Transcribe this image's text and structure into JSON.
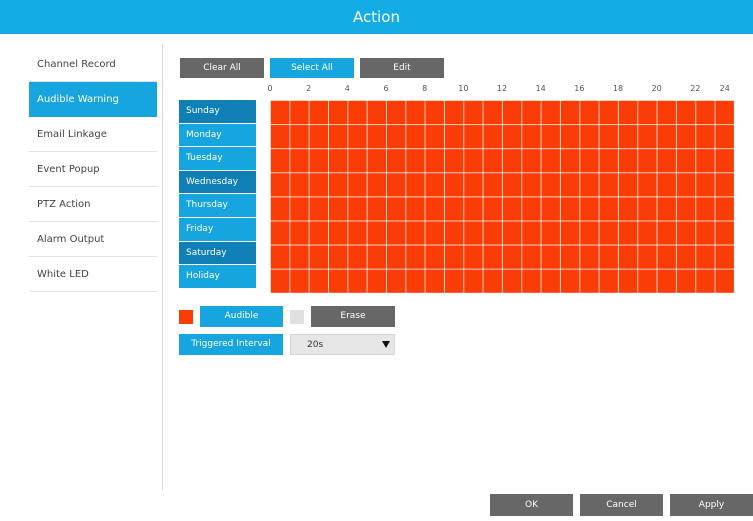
{
  "window": {
    "title": "Action"
  },
  "sidebar": {
    "items": [
      {
        "label": "Channel Record",
        "active": false
      },
      {
        "label": "Audible Warning",
        "active": true
      },
      {
        "label": "Email Linkage",
        "active": false
      },
      {
        "label": "Event Popup",
        "active": false
      },
      {
        "label": "PTZ Action",
        "active": false
      },
      {
        "label": "Alarm Output",
        "active": false
      },
      {
        "label": "White LED",
        "active": false
      }
    ]
  },
  "toolbar": {
    "clear_all": "Clear All",
    "select_all": "Select All",
    "edit": "Edit"
  },
  "schedule": {
    "hours": [
      "0",
      "2",
      "4",
      "6",
      "8",
      "10",
      "12",
      "14",
      "16",
      "18",
      "20",
      "22",
      "24"
    ],
    "days": [
      "Sunday",
      "Monday",
      "Tuesday",
      "Wednesday",
      "Thursday",
      "Friday",
      "Saturday",
      "Holiday"
    ],
    "fill_color": "#fa3d06",
    "all_slots_selected": true
  },
  "legend": {
    "audible_label": "Audible",
    "audible_color": "#fa3d06",
    "erase_label": "Erase",
    "erase_color": "#e0e0e0"
  },
  "triggered_interval": {
    "label": "Triggered Interval",
    "value": "20s"
  },
  "footer": {
    "ok": "OK",
    "cancel": "Cancel",
    "apply": "Apply"
  },
  "colors": {
    "accent": "#16a5de",
    "title_bar": "#13ace5",
    "button_gray": "#676767"
  }
}
